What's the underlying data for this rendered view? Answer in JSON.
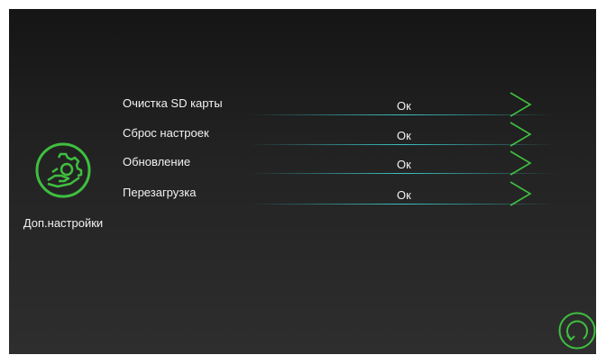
{
  "sidebar": {
    "icon": "settings-gear-hand-icon",
    "label": "Доп.настройки"
  },
  "menu": {
    "items": [
      {
        "label": "Очистка SD карты",
        "value": "Ок"
      },
      {
        "label": "Сброс настроек",
        "value": "Ок"
      },
      {
        "label": "Обновление",
        "value": "Ок"
      },
      {
        "label": "Перезагрузка",
        "value": "Ок"
      }
    ]
  },
  "footer": {
    "back_icon": "back-circle-icon"
  },
  "colors": {
    "accent": "#3fbf3f",
    "divider": "#3ed2d2",
    "text": "#f2f2f2"
  }
}
